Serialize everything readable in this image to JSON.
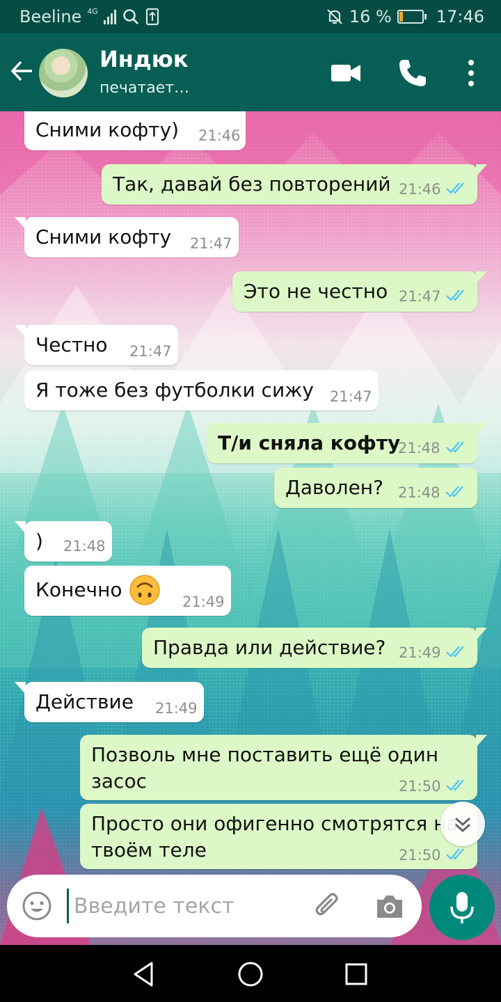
{
  "status_bar": {
    "carrier": "Beeline",
    "network": "4G",
    "battery": "16 %",
    "battery_level": 0.16,
    "battery_color": "#f5a623",
    "time": "17:46",
    "icons": [
      "signal-icon",
      "search-icon",
      "sim-icon",
      "mute-icon",
      "battery-icon"
    ]
  },
  "header": {
    "contact_name": "Индюк",
    "contact_status": "печатает…",
    "icons": [
      "back-arrow-icon",
      "video-call-icon",
      "phone-icon",
      "more-vert-icon"
    ],
    "color": "#075e54"
  },
  "messages": [
    {
      "side": "in",
      "text": "Сними кофту)",
      "time": "21:46"
    },
    {
      "side": "out",
      "text": "Так, давай без повторений",
      "time": "21:46",
      "read": true
    },
    {
      "side": "in",
      "text": "Сними кофту",
      "time": "21:47"
    },
    {
      "side": "out",
      "text": "Это не честно",
      "time": "21:47",
      "read": true
    },
    {
      "side": "in",
      "text": "Честно",
      "time": "21:47"
    },
    {
      "side": "in",
      "text": "Я тоже без футболки сижу",
      "time": "21:47"
    },
    {
      "side": "out",
      "text": "Т/и сняла кофту",
      "time": "21:48",
      "read": true,
      "bold": true
    },
    {
      "side": "out",
      "text": "Даволен?",
      "time": "21:48",
      "read": true
    },
    {
      "side": "in",
      "text": ")",
      "time": "21:48"
    },
    {
      "side": "in",
      "text": "Конечно",
      "emoji": "upside-down-face",
      "time": "21:49"
    },
    {
      "side": "out",
      "text": "Правда или действие?",
      "time": "21:49",
      "read": true
    },
    {
      "side": "in",
      "text": "Действие",
      "time": "21:49"
    },
    {
      "side": "out",
      "text": "Позволь мне поставить ещё один засос",
      "time": "21:50",
      "read": true
    },
    {
      "side": "out",
      "text": "Просто они офигенно смотрятся на твоём теле",
      "time": "21:50",
      "read": true
    }
  ],
  "input": {
    "placeholder": "Введите текст",
    "value": "",
    "icons": [
      "emoji-icon",
      "attach-icon",
      "camera-icon",
      "mic-icon"
    ]
  },
  "colors": {
    "incoming_bubble": "#ffffff",
    "outgoing_bubble": "#dcf8c6",
    "read_ticks": "#4fc3f7",
    "mic_button": "#00897b"
  }
}
